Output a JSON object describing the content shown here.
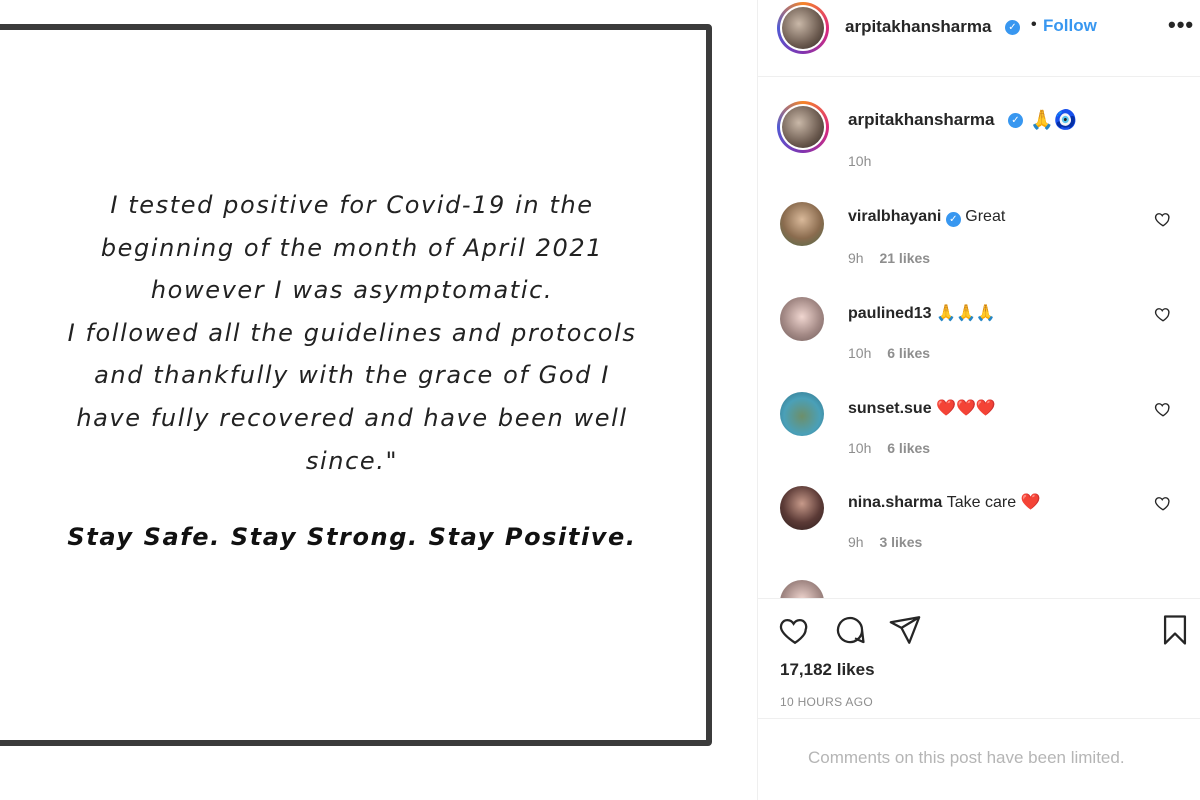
{
  "post": {
    "quote_lines": [
      "I tested positive for Covid-19 in the",
      "beginning of the month of April 2021",
      "however I was asymptomatic.",
      "I followed all the guidelines and protocols",
      "and thankfully with the grace of God I",
      "have fully recovered and have been well",
      "since.\""
    ],
    "tagline": "Stay Safe. Stay Strong. Stay Positive."
  },
  "header": {
    "username": "arpitakhansharma",
    "verified_icon": "verified-badge-icon",
    "separator": "•",
    "follow_label": "Follow",
    "more_label": "•••"
  },
  "caption": {
    "username": "arpitakhansharma",
    "text": "🙏🧿",
    "time": "10h"
  },
  "comments": [
    {
      "username": "viralbhayani",
      "verified": true,
      "text": "Great",
      "time": "9h",
      "likes": "21 likes"
    },
    {
      "username": "paulined13",
      "verified": false,
      "text": "🙏🙏🙏",
      "time": "10h",
      "likes": "6 likes"
    },
    {
      "username": "sunset.sue",
      "verified": false,
      "text": "❤️❤️❤️",
      "time": "10h",
      "likes": "6 likes"
    },
    {
      "username": "nina.sharma",
      "verified": false,
      "text": "Take care ❤️",
      "time": "9h",
      "likes": "3 likes"
    }
  ],
  "actions": {
    "like_icon": "heart-icon",
    "comment_icon": "comment-icon",
    "share_icon": "share-icon",
    "save_icon": "bookmark-icon",
    "likes_count": "17,182 likes",
    "timestamp": "10 HOURS AGO"
  },
  "footer": {
    "limited_text": "Comments on this post have been limited."
  },
  "colors": {
    "link_blue": "#3897f0",
    "muted_gray": "#8e8e8e",
    "frame_border": "#3b3b3b"
  }
}
